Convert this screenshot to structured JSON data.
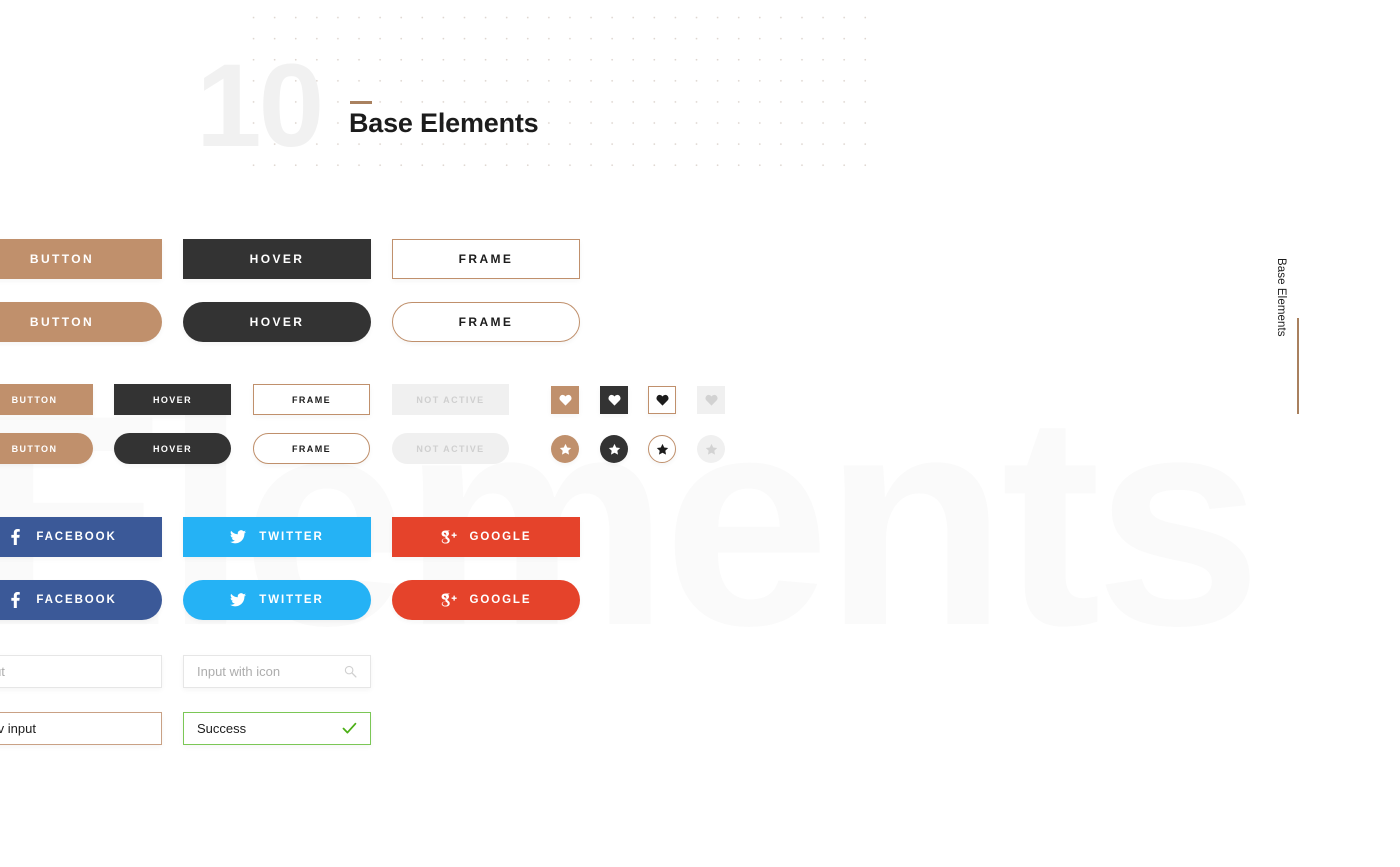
{
  "header": {
    "number": "10",
    "title": "Base Elements",
    "watermark": "Elements",
    "side_label": "Base Elements"
  },
  "colors": {
    "tan": "#c0906c",
    "dark": "#333333",
    "frame_border": "#c0906c",
    "disabled_bg": "#f0f0f0",
    "disabled_text": "#cfcfcf",
    "facebook": "#3b5998",
    "twitter": "#25b2f5",
    "google": "#e5432b",
    "success": "#7bc756",
    "accent_rule": "#a9815f"
  },
  "buttons_large": {
    "square": [
      {
        "label": "Button",
        "style": "tan"
      },
      {
        "label": "Hover",
        "style": "dark"
      },
      {
        "label": "Frame",
        "style": "frame"
      }
    ],
    "pill": [
      {
        "label": "Button",
        "style": "tan"
      },
      {
        "label": "Hover",
        "style": "dark"
      },
      {
        "label": "Frame",
        "style": "frame"
      }
    ]
  },
  "buttons_small": {
    "square": [
      {
        "label": "Button",
        "style": "tan"
      },
      {
        "label": "Hover",
        "style": "dark"
      },
      {
        "label": "Frame",
        "style": "frame"
      },
      {
        "label": "Not Active",
        "style": "disabled"
      }
    ],
    "pill": [
      {
        "label": "Button",
        "style": "tan"
      },
      {
        "label": "Hover",
        "style": "dark"
      },
      {
        "label": "Frame",
        "style": "frame"
      },
      {
        "label": "Not Active",
        "style": "disabled"
      }
    ]
  },
  "icon_buttons": {
    "square_row": [
      {
        "icon": "heart-icon",
        "style": "tan"
      },
      {
        "icon": "heart-icon",
        "style": "dark"
      },
      {
        "icon": "heart-icon",
        "style": "frame"
      },
      {
        "icon": "heart-icon",
        "style": "disabled"
      }
    ],
    "round_row": [
      {
        "icon": "star-icon",
        "style": "tan"
      },
      {
        "icon": "star-icon",
        "style": "dark"
      },
      {
        "icon": "star-icon",
        "style": "frame"
      },
      {
        "icon": "star-icon",
        "style": "disabled"
      }
    ]
  },
  "social_buttons": {
    "square": [
      {
        "label": "Facebook",
        "icon": "facebook-icon",
        "style": "fb"
      },
      {
        "label": "Twitter",
        "icon": "twitter-icon",
        "style": "tw"
      },
      {
        "label": "Google",
        "icon": "google-plus-icon",
        "style": "gp"
      }
    ],
    "pill": [
      {
        "label": "Facebook",
        "icon": "facebook-icon",
        "style": "fb"
      },
      {
        "label": "Twitter",
        "icon": "twitter-icon",
        "style": "tw"
      },
      {
        "label": "Google",
        "icon": "google-plus-icon",
        "style": "gp"
      }
    ]
  },
  "inputs": {
    "plain": {
      "placeholder": "Input",
      "value": ""
    },
    "with_icon": {
      "placeholder": "Input with icon",
      "value": "",
      "icon": "search-icon"
    },
    "active": {
      "value": "Activ input"
    },
    "success": {
      "value": "Success",
      "icon": "check-icon"
    }
  }
}
